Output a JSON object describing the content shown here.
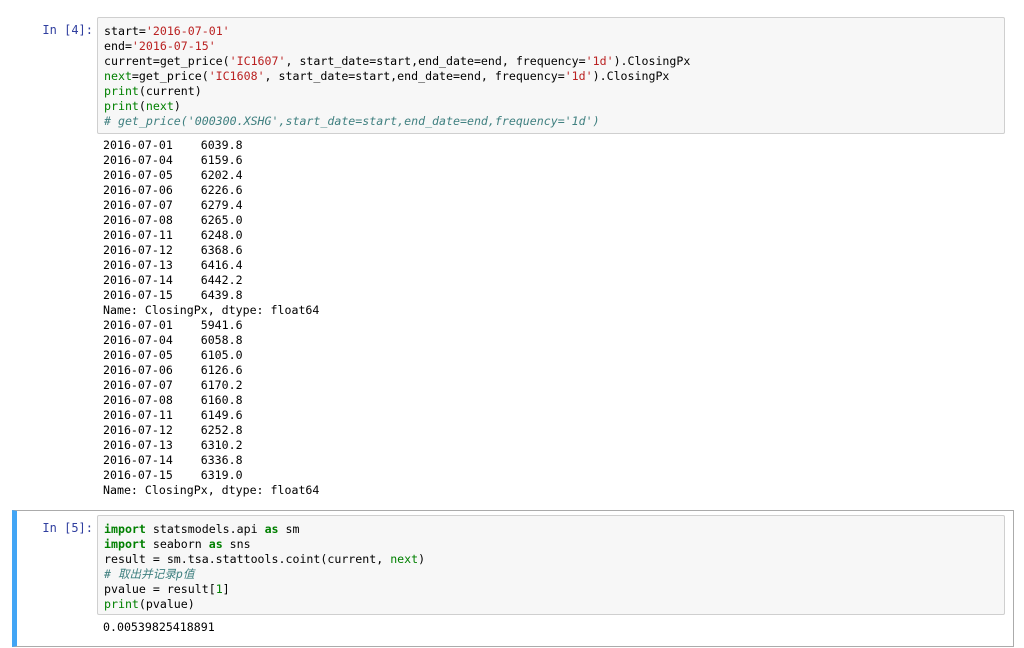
{
  "cell1": {
    "prompt": "In [4]:",
    "code": [
      [
        {
          "t": "start=",
          "c": ""
        },
        {
          "t": "'2016-07-01'",
          "c": "str"
        }
      ],
      [
        {
          "t": "end=",
          "c": ""
        },
        {
          "t": "'2016-07-15'",
          "c": "str"
        }
      ],
      [
        {
          "t": "current=get_price(",
          "c": ""
        },
        {
          "t": "'IC1607'",
          "c": "str"
        },
        {
          "t": ", start_date=start,end_date=end, frequency=",
          "c": ""
        },
        {
          "t": "'1d'",
          "c": "str"
        },
        {
          "t": ").ClosingPx",
          "c": ""
        }
      ],
      [
        {
          "t": "next",
          "c": "bi"
        },
        {
          "t": "=get_price(",
          "c": ""
        },
        {
          "t": "'IC1608'",
          "c": "str"
        },
        {
          "t": ", start_date=start,end_date=end, frequency=",
          "c": ""
        },
        {
          "t": "'1d'",
          "c": "str"
        },
        {
          "t": ").ClosingPx",
          "c": ""
        }
      ],
      [
        {
          "t": "print",
          "c": "bi"
        },
        {
          "t": "(current)",
          "c": ""
        }
      ],
      [
        {
          "t": "print",
          "c": "bi"
        },
        {
          "t": "(",
          "c": ""
        },
        {
          "t": "next",
          "c": "bi"
        },
        {
          "t": ")",
          "c": ""
        }
      ],
      [
        {
          "t": "# get_price('000300.XSHG',start_date=start,end_date=end,frequency='1d')",
          "c": "cm"
        }
      ]
    ],
    "output": [
      "2016-07-01    6039.8",
      "2016-07-04    6159.6",
      "2016-07-05    6202.4",
      "2016-07-06    6226.6",
      "2016-07-07    6279.4",
      "2016-07-08    6265.0",
      "2016-07-11    6248.0",
      "2016-07-12    6368.6",
      "2016-07-13    6416.4",
      "2016-07-14    6442.2",
      "2016-07-15    6439.8",
      "Name: ClosingPx, dtype: float64",
      "2016-07-01    5941.6",
      "2016-07-04    6058.8",
      "2016-07-05    6105.0",
      "2016-07-06    6126.6",
      "2016-07-07    6170.2",
      "2016-07-08    6160.8",
      "2016-07-11    6149.6",
      "2016-07-12    6252.8",
      "2016-07-13    6310.2",
      "2016-07-14    6336.8",
      "2016-07-15    6319.0",
      "Name: ClosingPx, dtype: float64"
    ]
  },
  "cell2": {
    "prompt": "In [5]:",
    "code": [
      [
        {
          "t": "import",
          "c": "kw"
        },
        {
          "t": " statsmodels.api ",
          "c": ""
        },
        {
          "t": "as",
          "c": "kw"
        },
        {
          "t": " sm",
          "c": ""
        }
      ],
      [
        {
          "t": "import",
          "c": "kw"
        },
        {
          "t": " seaborn ",
          "c": ""
        },
        {
          "t": "as",
          "c": "kw"
        },
        {
          "t": " sns",
          "c": ""
        }
      ],
      [
        {
          "t": "result = sm.tsa.stattools.coint(current, ",
          "c": ""
        },
        {
          "t": "next",
          "c": "bi"
        },
        {
          "t": ")",
          "c": ""
        }
      ],
      [
        {
          "t": "# 取出并记录p值",
          "c": "cm"
        }
      ],
      [
        {
          "t": "pvalue = result[",
          "c": ""
        },
        {
          "t": "1",
          "c": "bi"
        },
        {
          "t": "]",
          "c": ""
        }
      ],
      [
        {
          "t": "print",
          "c": "bi"
        },
        {
          "t": "(pvalue)",
          "c": ""
        }
      ]
    ],
    "output": [
      "0.00539825418891"
    ]
  }
}
